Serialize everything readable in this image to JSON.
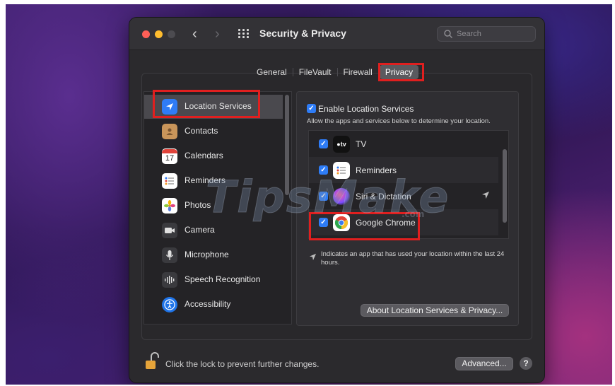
{
  "window": {
    "title": "Security & Privacy",
    "search_placeholder": "Search"
  },
  "tabs": [
    "General",
    "FileVault",
    "Firewall",
    "Privacy"
  ],
  "selected_tab": "Privacy",
  "sidebar": {
    "items": [
      {
        "label": "Location Services",
        "icon": "location-arrow-icon",
        "color": "#2f7cf6",
        "selected": true
      },
      {
        "label": "Contacts",
        "icon": "contacts-book-icon",
        "color": "#c9955a"
      },
      {
        "label": "Calendars",
        "icon": "calendar-icon",
        "color": "#ffffff",
        "glyph": "17"
      },
      {
        "label": "Reminders",
        "icon": "reminders-list-icon",
        "color": "#ffffff"
      },
      {
        "label": "Photos",
        "icon": "photos-flower-icon",
        "color": "#ffffff"
      },
      {
        "label": "Camera",
        "icon": "camera-icon",
        "color": "#3a3a3e"
      },
      {
        "label": "Microphone",
        "icon": "microphone-icon",
        "color": "#3a3a3e"
      },
      {
        "label": "Speech Recognition",
        "icon": "waveform-icon",
        "color": "#3a3a3e"
      },
      {
        "label": "Accessibility",
        "icon": "accessibility-icon",
        "color": "#1f74e8"
      }
    ]
  },
  "location": {
    "enable_label": "Enable Location Services",
    "enabled": true,
    "allow_text": "Allow the apps and services below to determine your location.",
    "apps": [
      {
        "name": "TV",
        "checked": true,
        "icon": "apple-tv-icon",
        "glyph": "tv",
        "used_recently": false
      },
      {
        "name": "Reminders",
        "checked": true,
        "icon": "reminders-icon",
        "used_recently": false
      },
      {
        "name": "Siri & Dictation",
        "checked": true,
        "icon": "siri-icon",
        "used_recently": true
      },
      {
        "name": "Google Chrome",
        "checked": true,
        "icon": "chrome-icon",
        "used_recently": false
      }
    ],
    "note": "Indicates an app that has used your location within the last 24 hours.",
    "about_button": "About Location Services & Privacy..."
  },
  "footer": {
    "lock_text": "Click the lock to prevent further changes.",
    "advanced_button": "Advanced...",
    "help_button": "?"
  },
  "watermark": {
    "main": "TipsMake",
    "sub": ".com"
  }
}
